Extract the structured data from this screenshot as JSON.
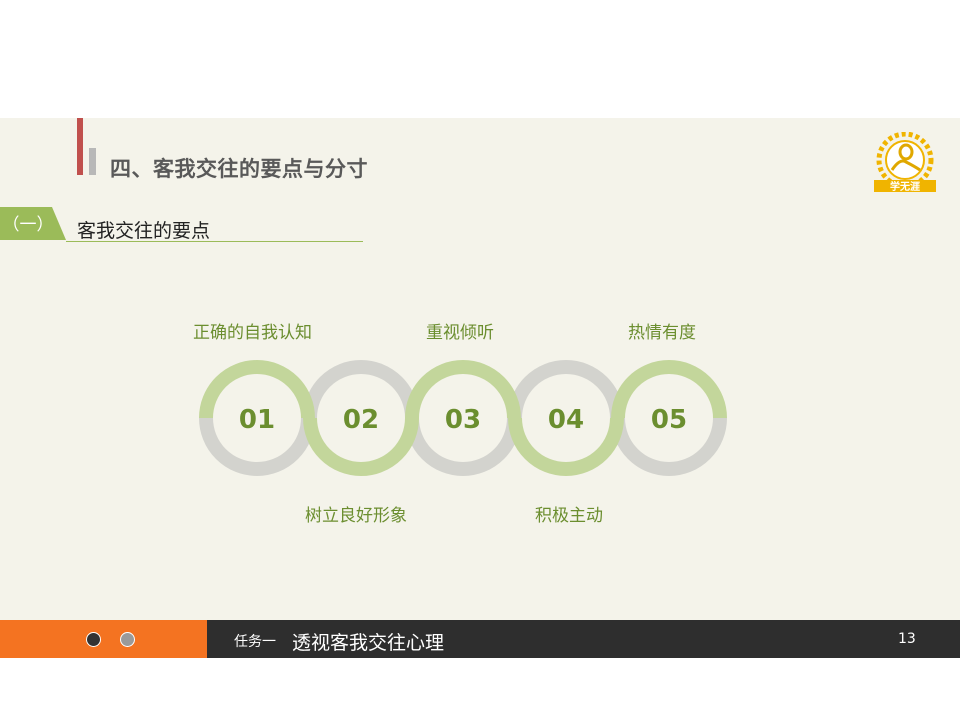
{
  "slide": {
    "title": "四、客我交往的要点与分寸",
    "section_tag": "（一）",
    "section_label": "客我交往的要点",
    "logo_text": "学无涯"
  },
  "points": [
    {
      "number": "01",
      "label": "正确的自我认知"
    },
    {
      "number": "02",
      "label": "树立良好形象"
    },
    {
      "number": "03",
      "label": "重视倾听"
    },
    {
      "number": "04",
      "label": "积极主动"
    },
    {
      "number": "05",
      "label": "热情有度"
    }
  ],
  "footer": {
    "task": "任务一",
    "topic": "透视客我交往心理",
    "page": "13"
  },
  "colors": {
    "accent_green": "#9bbb59",
    "ring_green": "#c3d69b",
    "ring_grey": "#d3d3ce",
    "number_green": "#6b8e2f",
    "footer_orange": "#f47321",
    "footer_dark": "#2e2e2e",
    "title_red": "#c0504d"
  }
}
